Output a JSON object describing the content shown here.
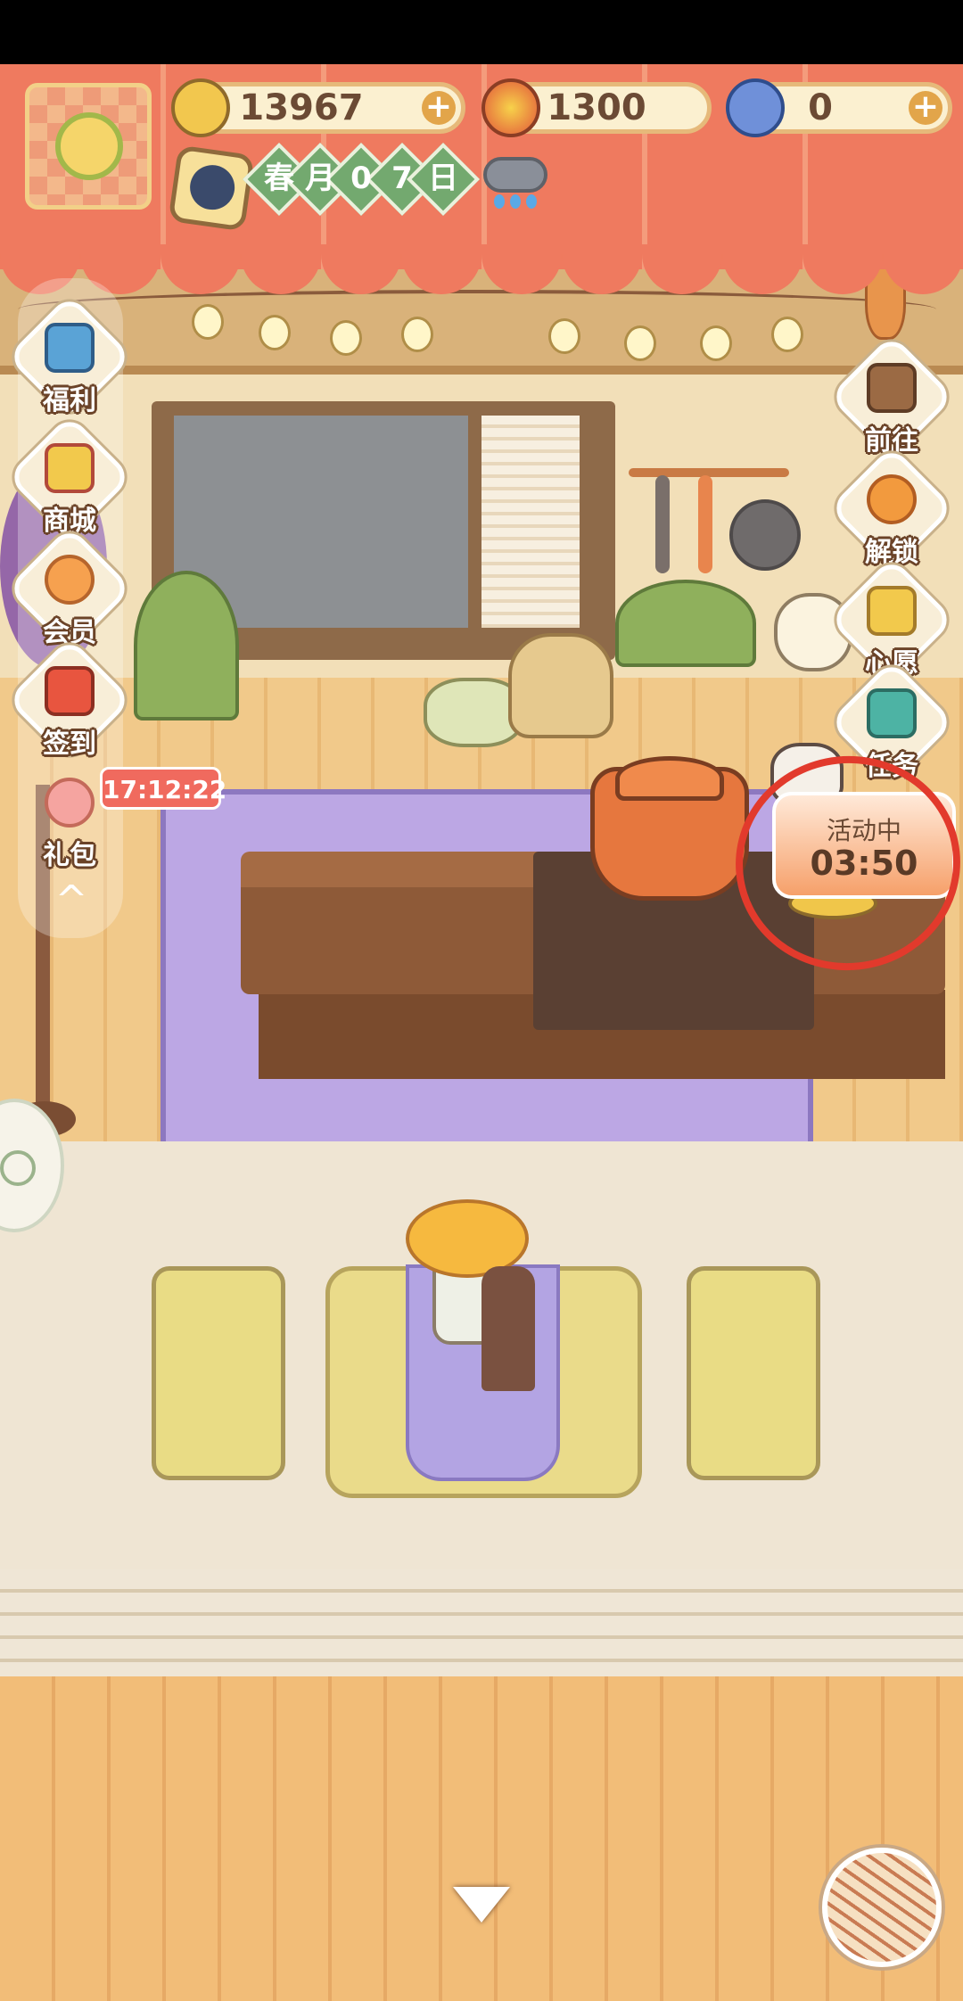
{
  "header": {
    "currencies": [
      {
        "icon": "banana-icon",
        "value": "13967",
        "has_plus": true
      },
      {
        "icon": "flame-icon",
        "value": "1300",
        "has_plus": false
      },
      {
        "icon": "fish-icon",
        "value": "0",
        "has_plus": true
      }
    ],
    "date_chars": [
      "春",
      "月",
      "0",
      "7",
      "日"
    ],
    "weather_icon": "rain-cloud-icon"
  },
  "left_menu": [
    {
      "label": "福利",
      "icon": "tv-icon"
    },
    {
      "label": "商城",
      "icon": "shop-icon"
    },
    {
      "label": "会员",
      "icon": "flower-badge-icon"
    },
    {
      "label": "签到",
      "icon": "calendar-icon"
    },
    {
      "label": "礼包",
      "icon": "gift-icon"
    }
  ],
  "gift_timer": "17:12:22",
  "right_menu": [
    {
      "label": "前往",
      "icon": "signboard-icon"
    },
    {
      "label": "解锁",
      "icon": "key-icon"
    },
    {
      "label": "心愿",
      "icon": "heart-book-icon"
    },
    {
      "label": "任务",
      "icon": "clipboard-icon"
    }
  ],
  "event": {
    "status": "活动中",
    "time": "03:50"
  },
  "colors": {
    "awning": "#ef7a5f",
    "annotation_circle": "#e23a2c",
    "label_outline": "#6b4328"
  }
}
